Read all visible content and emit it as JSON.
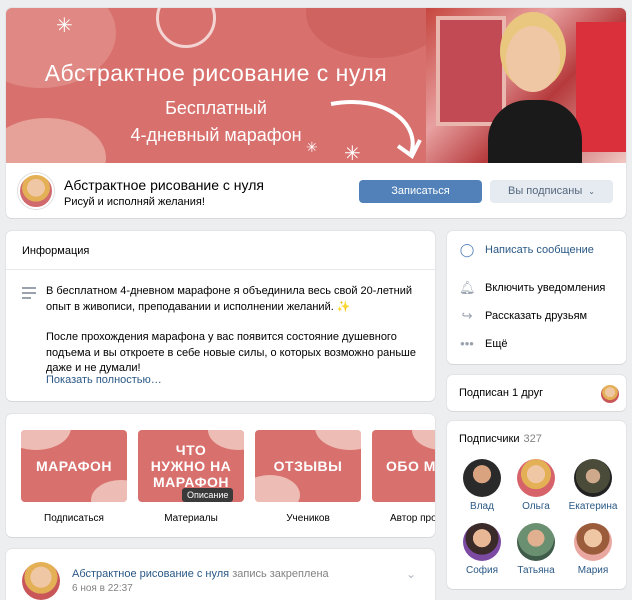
{
  "cover": {
    "title": "Абстрактное рисование с нуля",
    "subtitle_line1": "Бесплатный",
    "subtitle_line2": "4-дневный марафон"
  },
  "group": {
    "name": "Абстрактное рисование с нуля",
    "status": "Рисуй и исполняй желания!",
    "join_label": "Записаться",
    "subscribed_label": "Вы подписаны",
    "subscribed_icon": "chevron-down-icon"
  },
  "info": {
    "title": "Информация",
    "paragraph1": "В бесплатном 4-дневном марафоне я объединила весь свой 20-летний опыт в живописи, преподавании и исполнении желаний. ✨",
    "paragraph2": "После прохождения марафона у вас появится состояние душевного подъема и вы откроете в себе новые силы, о которых возможно раньше даже и не думали!",
    "more": "Показать полностью…"
  },
  "actions": [
    {
      "label": "Написать сообщение",
      "icon": "message-icon",
      "color": "#2a5885"
    },
    {
      "label": "Включить уведомления",
      "icon": "bell-icon",
      "color": "#000000"
    },
    {
      "label": "Рассказать друзьям",
      "icon": "share-icon",
      "color": "#000000"
    },
    {
      "label": "Ещё",
      "icon": "more-icon",
      "color": "#000000"
    }
  ],
  "friends": {
    "label": "Подписан 1 друг"
  },
  "subscribers": {
    "title": "Подписчики",
    "count": "327",
    "people": [
      {
        "name": "Влад"
      },
      {
        "name": "Ольга"
      },
      {
        "name": "Екатерина"
      },
      {
        "name": "София"
      },
      {
        "name": "Татьяна"
      },
      {
        "name": "Мария"
      }
    ]
  },
  "menu": {
    "tiles": [
      {
        "image_text": "МАРАФОН",
        "caption": "Подписаться"
      },
      {
        "image_text": "ЧТО НУЖНО НА МАРАФОН",
        "caption": "Материалы"
      },
      {
        "image_text": "ОТЗЫВЫ",
        "caption": "Учеников"
      },
      {
        "image_text": "ОБО МНЕ",
        "caption": "Автор проекта"
      }
    ],
    "tooltip": "Описание"
  },
  "post": {
    "author": "Абстрактное рисование с нуля",
    "pinned": "запись закреплена",
    "date": "6 ноя в 22:37"
  },
  "colors": {
    "accent": "#5181b8",
    "cover": "#d8706d",
    "link": "#2a5885"
  }
}
